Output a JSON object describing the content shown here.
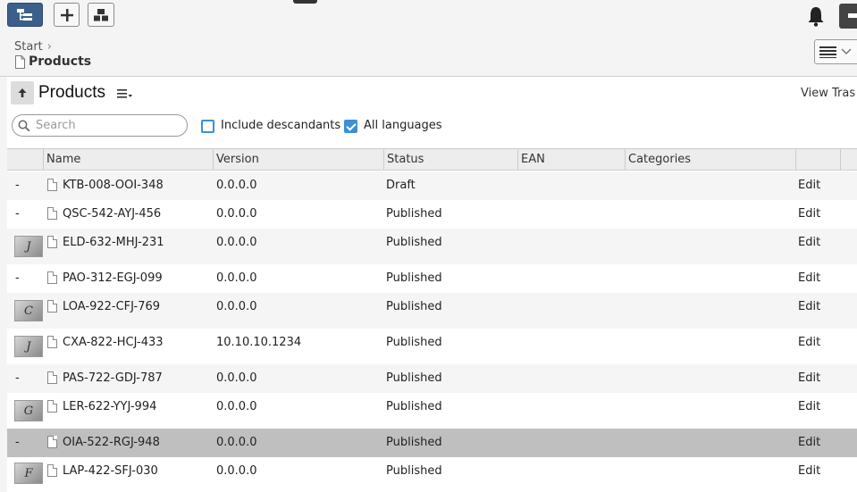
{
  "toolbar": {
    "tree_icon": "tree-view-icon",
    "add_icon": "plus-icon",
    "blocks_icon": "blocks-icon",
    "bell_icon": "bell-icon",
    "accent": "#3b5f8a"
  },
  "breadcrumb": {
    "start": "Start",
    "current": "Products"
  },
  "header": {
    "title": "Products",
    "view_trash": "View Tras"
  },
  "filters": {
    "search_placeholder": "Search",
    "include_descendants": "Include descandants",
    "include_descendants_checked": false,
    "all_languages": "All languages",
    "all_languages_checked": true
  },
  "table": {
    "columns": [
      "Name",
      "Version",
      "Status",
      "EAN",
      "Categories"
    ],
    "edit_label": "Edit",
    "rows": [
      {
        "thumb": "-",
        "name": "KTB-008-OOI-348",
        "version": "0.0.0.0",
        "status": "Draft"
      },
      {
        "thumb": "-",
        "name": "QSC-542-AYJ-456",
        "version": "0.0.0.0",
        "status": "Published"
      },
      {
        "thumb": "J",
        "name": "ELD-632-MHJ-231",
        "version": "0.0.0.0",
        "status": "Published"
      },
      {
        "thumb": "-",
        "name": "PAO-312-EGJ-099",
        "version": "0.0.0.0",
        "status": "Published"
      },
      {
        "thumb": "C",
        "name": "LOA-922-CFJ-769",
        "version": "0.0.0.0",
        "status": "Published"
      },
      {
        "thumb": "J",
        "name": "CXA-822-HCJ-433",
        "version": "10.10.10.1234",
        "status": "Published"
      },
      {
        "thumb": "-",
        "name": "PAS-722-GDJ-787",
        "version": "0.0.0.0",
        "status": "Published"
      },
      {
        "thumb": "G",
        "name": "LER-622-YYJ-994",
        "version": "0.0.0.0",
        "status": "Published"
      },
      {
        "thumb": "-",
        "name": "OIA-522-RGJ-948",
        "version": "0.0.0.0",
        "status": "Published",
        "selected": true
      },
      {
        "thumb": "F",
        "name": "LAP-422-SFJ-030",
        "version": "0.0.0.0",
        "status": "Published"
      }
    ]
  }
}
